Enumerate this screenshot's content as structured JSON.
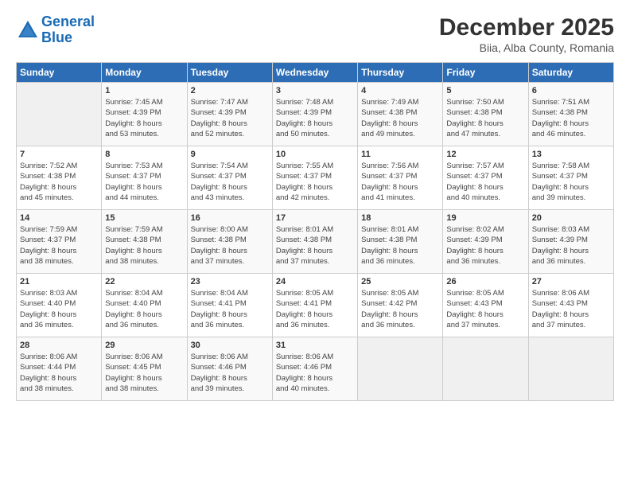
{
  "header": {
    "logo_line1": "General",
    "logo_line2": "Blue",
    "month": "December 2025",
    "location": "Biia, Alba County, Romania"
  },
  "weekdays": [
    "Sunday",
    "Monday",
    "Tuesday",
    "Wednesday",
    "Thursday",
    "Friday",
    "Saturday"
  ],
  "weeks": [
    [
      {
        "day": "",
        "sunrise": "",
        "sunset": "",
        "daylight": ""
      },
      {
        "day": "1",
        "sunrise": "Sunrise: 7:45 AM",
        "sunset": "Sunset: 4:39 PM",
        "daylight": "Daylight: 8 hours and 53 minutes."
      },
      {
        "day": "2",
        "sunrise": "Sunrise: 7:47 AM",
        "sunset": "Sunset: 4:39 PM",
        "daylight": "Daylight: 8 hours and 52 minutes."
      },
      {
        "day": "3",
        "sunrise": "Sunrise: 7:48 AM",
        "sunset": "Sunset: 4:39 PM",
        "daylight": "Daylight: 8 hours and 50 minutes."
      },
      {
        "day": "4",
        "sunrise": "Sunrise: 7:49 AM",
        "sunset": "Sunset: 4:38 PM",
        "daylight": "Daylight: 8 hours and 49 minutes."
      },
      {
        "day": "5",
        "sunrise": "Sunrise: 7:50 AM",
        "sunset": "Sunset: 4:38 PM",
        "daylight": "Daylight: 8 hours and 47 minutes."
      },
      {
        "day": "6",
        "sunrise": "Sunrise: 7:51 AM",
        "sunset": "Sunset: 4:38 PM",
        "daylight": "Daylight: 8 hours and 46 minutes."
      }
    ],
    [
      {
        "day": "7",
        "sunrise": "Sunrise: 7:52 AM",
        "sunset": "Sunset: 4:38 PM",
        "daylight": "Daylight: 8 hours and 45 minutes."
      },
      {
        "day": "8",
        "sunrise": "Sunrise: 7:53 AM",
        "sunset": "Sunset: 4:37 PM",
        "daylight": "Daylight: 8 hours and 44 minutes."
      },
      {
        "day": "9",
        "sunrise": "Sunrise: 7:54 AM",
        "sunset": "Sunset: 4:37 PM",
        "daylight": "Daylight: 8 hours and 43 minutes."
      },
      {
        "day": "10",
        "sunrise": "Sunrise: 7:55 AM",
        "sunset": "Sunset: 4:37 PM",
        "daylight": "Daylight: 8 hours and 42 minutes."
      },
      {
        "day": "11",
        "sunrise": "Sunrise: 7:56 AM",
        "sunset": "Sunset: 4:37 PM",
        "daylight": "Daylight: 8 hours and 41 minutes."
      },
      {
        "day": "12",
        "sunrise": "Sunrise: 7:57 AM",
        "sunset": "Sunset: 4:37 PM",
        "daylight": "Daylight: 8 hours and 40 minutes."
      },
      {
        "day": "13",
        "sunrise": "Sunrise: 7:58 AM",
        "sunset": "Sunset: 4:37 PM",
        "daylight": "Daylight: 8 hours and 39 minutes."
      }
    ],
    [
      {
        "day": "14",
        "sunrise": "Sunrise: 7:59 AM",
        "sunset": "Sunset: 4:37 PM",
        "daylight": "Daylight: 8 hours and 38 minutes."
      },
      {
        "day": "15",
        "sunrise": "Sunrise: 7:59 AM",
        "sunset": "Sunset: 4:38 PM",
        "daylight": "Daylight: 8 hours and 38 minutes."
      },
      {
        "day": "16",
        "sunrise": "Sunrise: 8:00 AM",
        "sunset": "Sunset: 4:38 PM",
        "daylight": "Daylight: 8 hours and 37 minutes."
      },
      {
        "day": "17",
        "sunrise": "Sunrise: 8:01 AM",
        "sunset": "Sunset: 4:38 PM",
        "daylight": "Daylight: 8 hours and 37 minutes."
      },
      {
        "day": "18",
        "sunrise": "Sunrise: 8:01 AM",
        "sunset": "Sunset: 4:38 PM",
        "daylight": "Daylight: 8 hours and 36 minutes."
      },
      {
        "day": "19",
        "sunrise": "Sunrise: 8:02 AM",
        "sunset": "Sunset: 4:39 PM",
        "daylight": "Daylight: 8 hours and 36 minutes."
      },
      {
        "day": "20",
        "sunrise": "Sunrise: 8:03 AM",
        "sunset": "Sunset: 4:39 PM",
        "daylight": "Daylight: 8 hours and 36 minutes."
      }
    ],
    [
      {
        "day": "21",
        "sunrise": "Sunrise: 8:03 AM",
        "sunset": "Sunset: 4:40 PM",
        "daylight": "Daylight: 8 hours and 36 minutes."
      },
      {
        "day": "22",
        "sunrise": "Sunrise: 8:04 AM",
        "sunset": "Sunset: 4:40 PM",
        "daylight": "Daylight: 8 hours and 36 minutes."
      },
      {
        "day": "23",
        "sunrise": "Sunrise: 8:04 AM",
        "sunset": "Sunset: 4:41 PM",
        "daylight": "Daylight: 8 hours and 36 minutes."
      },
      {
        "day": "24",
        "sunrise": "Sunrise: 8:05 AM",
        "sunset": "Sunset: 4:41 PM",
        "daylight": "Daylight: 8 hours and 36 minutes."
      },
      {
        "day": "25",
        "sunrise": "Sunrise: 8:05 AM",
        "sunset": "Sunset: 4:42 PM",
        "daylight": "Daylight: 8 hours and 36 minutes."
      },
      {
        "day": "26",
        "sunrise": "Sunrise: 8:05 AM",
        "sunset": "Sunset: 4:43 PM",
        "daylight": "Daylight: 8 hours and 37 minutes."
      },
      {
        "day": "27",
        "sunrise": "Sunrise: 8:06 AM",
        "sunset": "Sunset: 4:43 PM",
        "daylight": "Daylight: 8 hours and 37 minutes."
      }
    ],
    [
      {
        "day": "28",
        "sunrise": "Sunrise: 8:06 AM",
        "sunset": "Sunset: 4:44 PM",
        "daylight": "Daylight: 8 hours and 38 minutes."
      },
      {
        "day": "29",
        "sunrise": "Sunrise: 8:06 AM",
        "sunset": "Sunset: 4:45 PM",
        "daylight": "Daylight: 8 hours and 38 minutes."
      },
      {
        "day": "30",
        "sunrise": "Sunrise: 8:06 AM",
        "sunset": "Sunset: 4:46 PM",
        "daylight": "Daylight: 8 hours and 39 minutes."
      },
      {
        "day": "31",
        "sunrise": "Sunrise: 8:06 AM",
        "sunset": "Sunset: 4:46 PM",
        "daylight": "Daylight: 8 hours and 40 minutes."
      },
      {
        "day": "",
        "sunrise": "",
        "sunset": "",
        "daylight": ""
      },
      {
        "day": "",
        "sunrise": "",
        "sunset": "",
        "daylight": ""
      },
      {
        "day": "",
        "sunrise": "",
        "sunset": "",
        "daylight": ""
      }
    ]
  ]
}
